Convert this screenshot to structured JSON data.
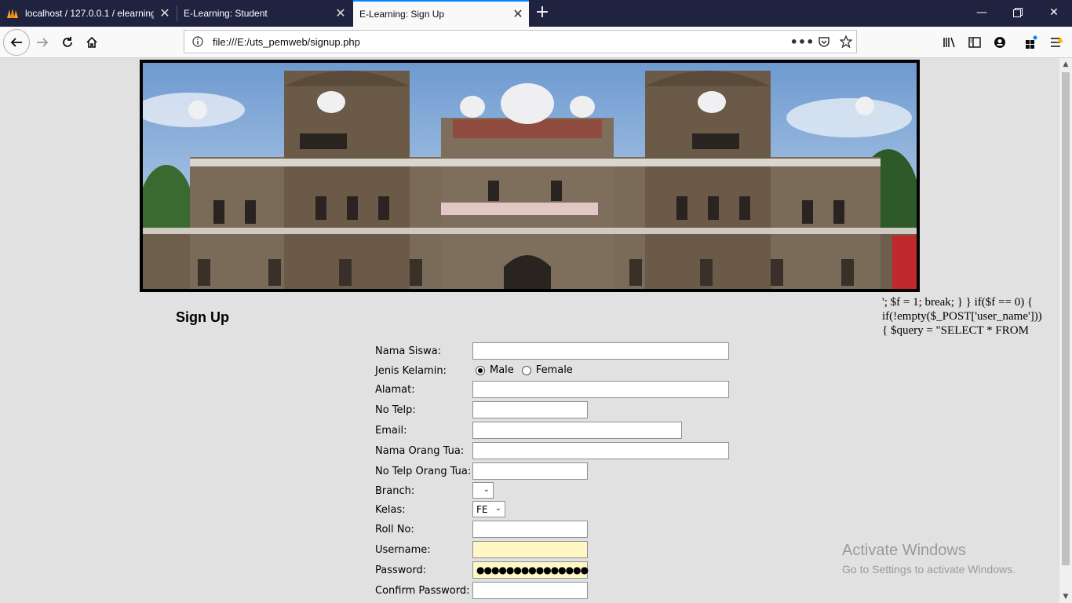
{
  "browser": {
    "tabs": [
      {
        "title": "localhost / 127.0.0.1 / elearning",
        "active": false
      },
      {
        "title": "E-Learning: Student",
        "active": false
      },
      {
        "title": "E-Learning: Sign Up",
        "active": true
      }
    ],
    "url": "file:///E:/uts_pemweb/signup.php"
  },
  "page": {
    "leaked_code": "'; $f = 1; break; } } if($f == 0) {\nif(!empty($_POST['user_name']))\n{ $query = \"SELECT * FROM",
    "heading": "Sign Up",
    "form": {
      "nama_siswa": {
        "label": "Nama Siswa:",
        "value": ""
      },
      "jenis_kelamin": {
        "label": "Jenis Kelamin:",
        "options": [
          "Male",
          "Female"
        ],
        "selected": "Male"
      },
      "alamat": {
        "label": "Alamat:",
        "value": ""
      },
      "no_telp": {
        "label": "No Telp:",
        "value": ""
      },
      "email": {
        "label": "Email:",
        "value": ""
      },
      "nama_orang_tua": {
        "label": "Nama Orang Tua:",
        "value": ""
      },
      "no_telp_orang_tua": {
        "label": "No Telp Orang Tua:",
        "value": ""
      },
      "branch": {
        "label": "Branch:",
        "value": ""
      },
      "kelas": {
        "label": "Kelas:",
        "value": "FE"
      },
      "roll_no": {
        "label": "Roll No:",
        "value": ""
      },
      "username": {
        "label": "Username:",
        "value": ""
      },
      "password": {
        "label": "Password:",
        "masked": "●●●●●●●●●●●●●●●"
      },
      "confirm_password": {
        "label": "Confirm Password:",
        "value": ""
      }
    }
  },
  "watermark": {
    "title": "Activate Windows",
    "subtitle": "Go to Settings to activate Windows."
  },
  "colors": {
    "tabbar": "#202340",
    "accent": "#0a84ff",
    "autofill": "#fff8c4",
    "page_bg": "#e1e1e1"
  }
}
